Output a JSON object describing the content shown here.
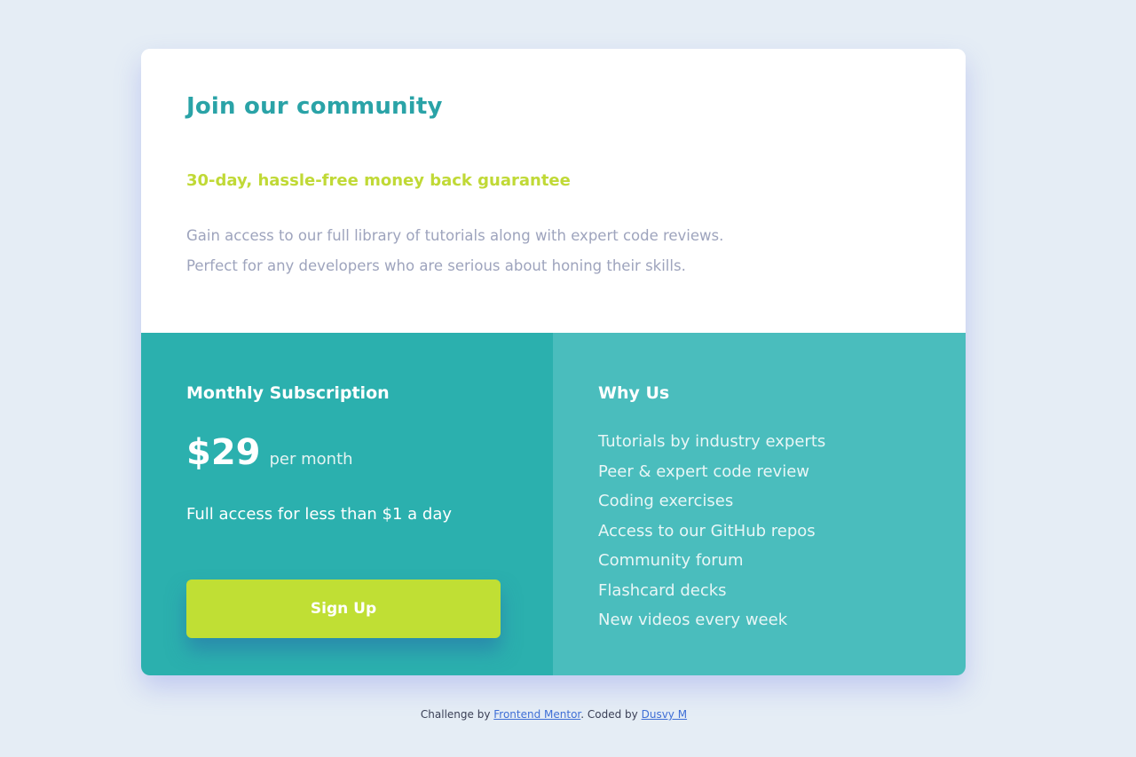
{
  "card": {
    "title": "Join our community",
    "guarantee": "30-day, hassle-free money back guarantee",
    "description_line1": "Gain access to our full library of tutorials along with expert code reviews.",
    "description_line2": "Perfect for any developers who are serious about honing their skills."
  },
  "subscription": {
    "heading": "Monthly Subscription",
    "price": "$29",
    "period": "per month",
    "note": "Full access for less than $1 a day",
    "button_label": "Sign Up"
  },
  "why_us": {
    "heading": "Why Us",
    "items": [
      "Tutorials by industry experts",
      "Peer & expert code review",
      "Coding exercises",
      "Access to our GitHub repos",
      "Community forum",
      "Flashcard decks",
      "New videos every week"
    ]
  },
  "footer": {
    "prefix": "Challenge by ",
    "link1": "Frontend Mentor",
    "middle": ". Coded by ",
    "link2": "Dusvy M"
  },
  "colors": {
    "background": "#e5edf5",
    "title": "#2aa3a7",
    "guarantee": "#c0d936",
    "description": "#9ea4bd",
    "subscription_panel": "#2bb0ae",
    "why_panel": "#4abdbd",
    "button": "#c0df34"
  }
}
